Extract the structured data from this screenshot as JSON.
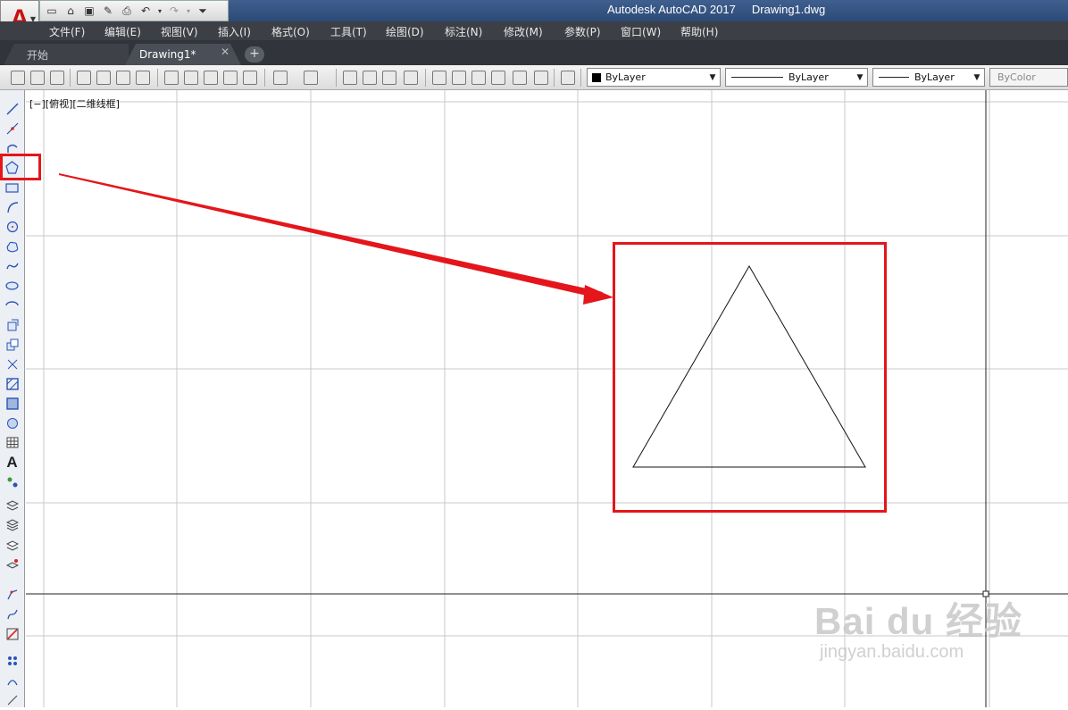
{
  "app": {
    "logo_letter": "A",
    "title": "Autodesk AutoCAD 2017     Drawing1.dwg",
    "accent_color": "#c81010"
  },
  "quick_access": {
    "icons": [
      "new-file-icon",
      "open-folder-icon",
      "save-icon",
      "save-as-icon",
      "print-icon",
      "undo-icon",
      "redo-icon",
      "customize-dropdown-icon"
    ]
  },
  "menu": {
    "items": [
      "文件(F)",
      "编辑(E)",
      "视图(V)",
      "插入(I)",
      "格式(O)",
      "工具(T)",
      "绘图(D)",
      "标注(N)",
      "修改(M)",
      "参数(P)",
      "窗口(W)",
      "帮助(H)"
    ]
  },
  "tabs": {
    "start": "开始",
    "drawing": "Drawing1*",
    "close_glyph": "✕",
    "add_glyph": "+"
  },
  "toolbar": {
    "color_combo": "ByLayer",
    "linetype_combo": "ByLayer",
    "lineweight_combo": "ByLayer",
    "plotstyle_combo": "ByColor"
  },
  "left_toolbar": {
    "text_tool_glyph": "A"
  },
  "viewport": {
    "label": "[−][俯视][二维线框]"
  },
  "watermark": {
    "main": "Bai du 经验",
    "sub": "jingyan.baidu.com"
  },
  "colors": {
    "highlight": "#e4161b",
    "grid": "#c4c8ce",
    "axis": "#222222",
    "menubar_bg": "#3c3f46"
  }
}
